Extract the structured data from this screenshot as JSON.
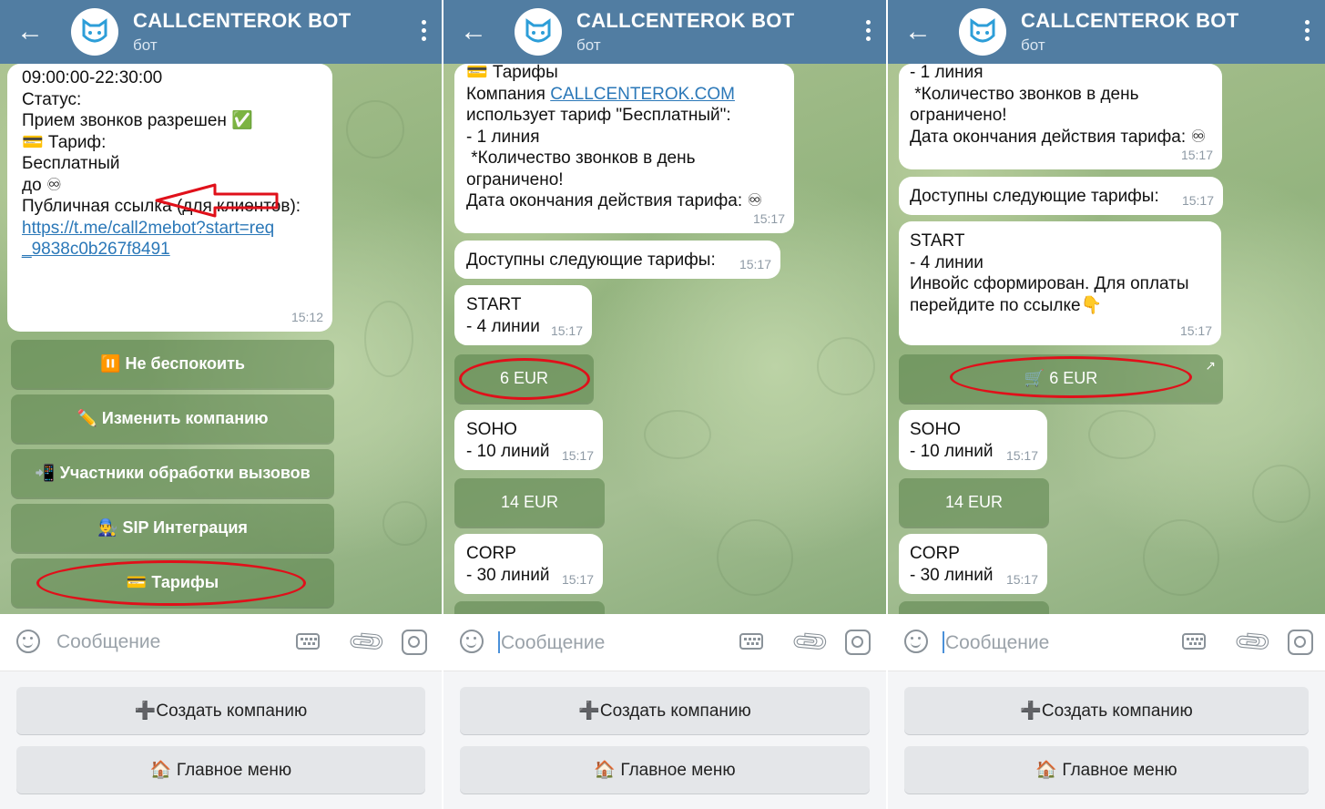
{
  "header": {
    "bot_name": "CALLCENTEROK BOT",
    "subtitle": "бот"
  },
  "input": {
    "placeholder": "Сообщение"
  },
  "reply_keyboard": {
    "create_company": "➕Создать компанию",
    "main_menu": "🏠 Главное меню"
  },
  "panel1": {
    "message": {
      "lines": [
        "09:00:00-22:30:00",
        "",
        "Статус:",
        "Прием звонков разрешен ✅",
        "",
        "💳 Тариф:",
        "Бесплатный",
        "до ♾",
        "",
        "Публичная ссылка (для клиентов):"
      ],
      "link_line1": "https://t.me/call2mebot?start=req",
      "link_line2": "_9838c0b267f8491",
      "time": "15:12"
    },
    "buttons": [
      "⏸️ Не беспокоить",
      "✏️ Изменить компанию",
      "📲 Участники обработки вызовов",
      "👨‍🔧 SIP Интеграция",
      "💳 Тарифы"
    ]
  },
  "panel2": {
    "tariff_msg": {
      "line1": "💳 Тарифы",
      "company_prefix": "Компания ",
      "company_link": "CALLCENTEROK.COM",
      "line3": "использует тариф \"Бесплатный\":",
      "line4": "- 1 линия",
      "line5": " *Количество звонков в день",
      "line6": "ограничено!",
      "line7": "Дата окончания действия тарифа: ♾",
      "time": "15:17"
    },
    "available": {
      "text": "Доступны следующие тарифы:",
      "time": "15:17"
    },
    "plans": [
      {
        "name": "START",
        "lines": "- 4 линии",
        "time": "15:17",
        "button": "6 EUR"
      },
      {
        "name": "SOHO",
        "lines": "- 10 линий",
        "time": "15:17",
        "button": "14 EUR"
      },
      {
        "name": "CORP",
        "lines": "- 30 линий",
        "time": "15:17"
      }
    ]
  },
  "panel3": {
    "tariff_tail": {
      "line1": "- 1 линия",
      "line2": " *Количество звонков в день",
      "line3": "ограничено!",
      "line4": "Дата окончания действия тарифа: ♾",
      "time": "15:17"
    },
    "available": {
      "text": "Доступны следующие тарифы:",
      "time": "15:17"
    },
    "start": {
      "name": "START",
      "lines": "- 4 линии",
      "blank": "",
      "invoice1": "Инвойс сформирован. Для оплаты",
      "invoice2": "перейдите по ссылке👇",
      "time": "15:17"
    },
    "pay_button": "🛒 6 EUR",
    "soho": {
      "name": "SOHO",
      "lines": "- 10 линий",
      "time": "15:17",
      "button": "14 EUR"
    },
    "corp": {
      "name": "CORP",
      "lines": "- 30 линий",
      "time": "15:17"
    }
  },
  "colors": {
    "header": "#517da2",
    "link": "#2b78b8",
    "annotation": "#e0101a",
    "button_bg": "#5a824b"
  }
}
